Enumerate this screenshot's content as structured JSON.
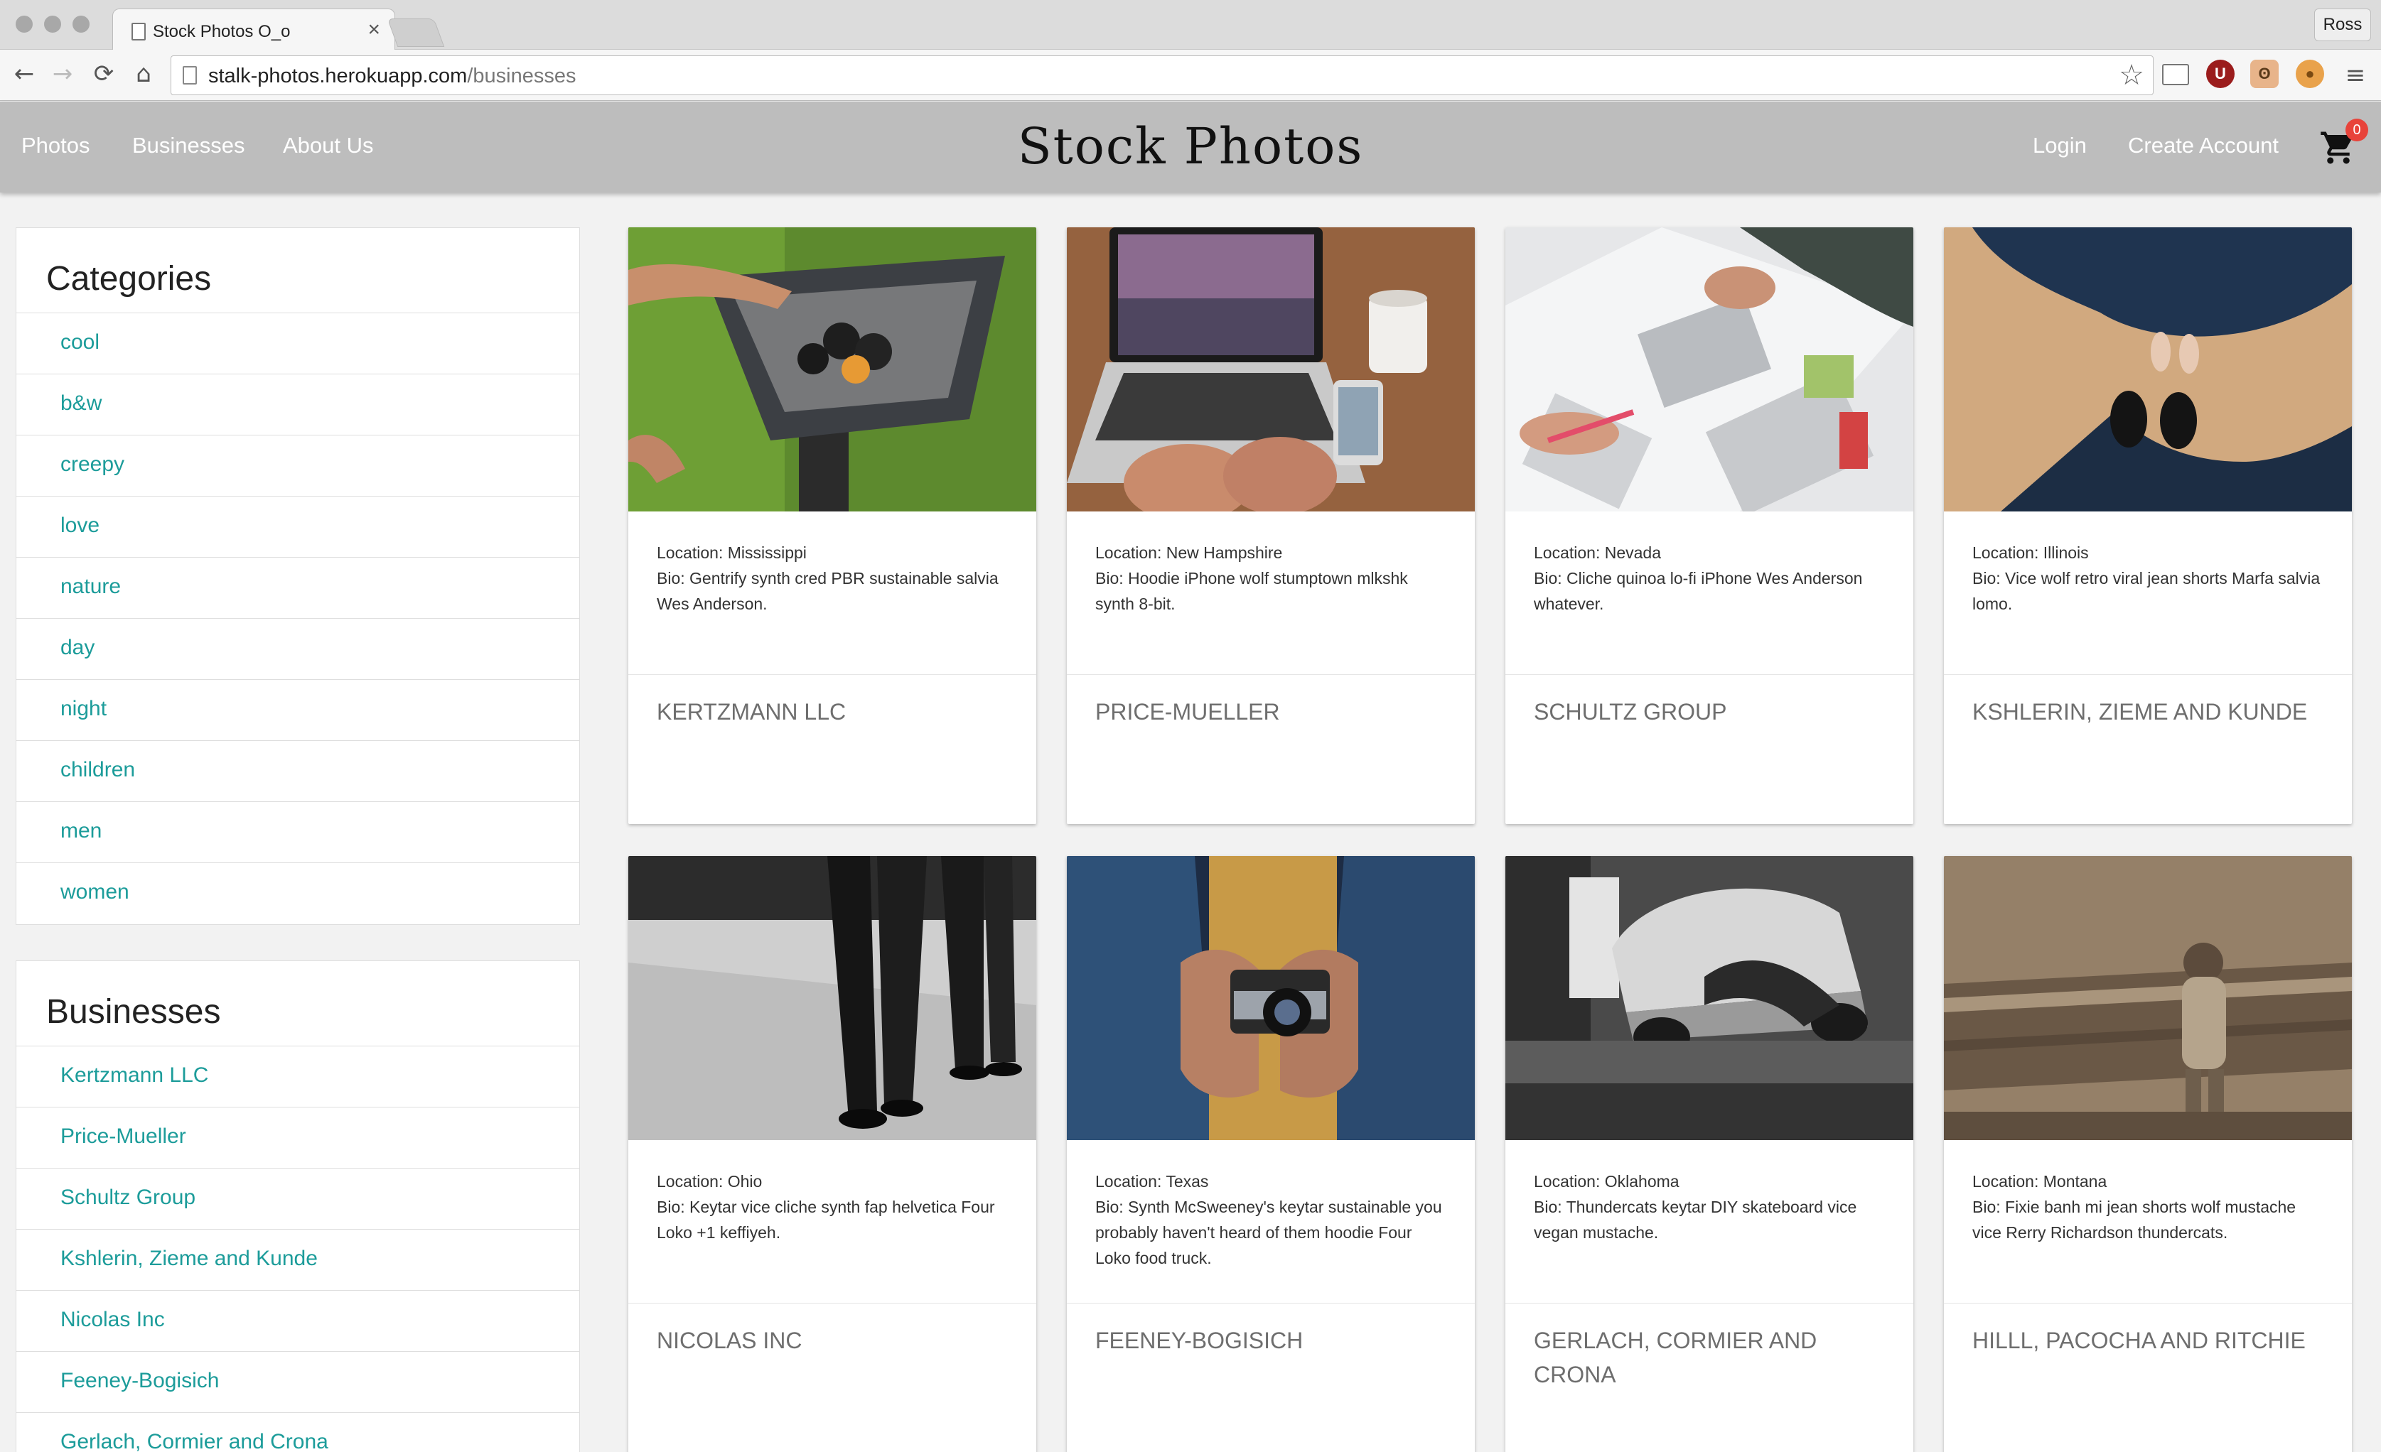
{
  "browser": {
    "tab_title": "Stock Photos O_o",
    "url_host": "stalk-photos.herokuapp.com",
    "url_path": "/businesses",
    "profile_name": "Ross"
  },
  "nav": {
    "left_links": [
      "Photos",
      "Businesses",
      "About Us"
    ],
    "brand": "Stock Photos",
    "login": "Login",
    "create_account": "Create Account",
    "cart_count": "0"
  },
  "categories": {
    "title": "Categories",
    "items": [
      "cool",
      "b&w",
      "creepy",
      "love",
      "nature",
      "day",
      "night",
      "children",
      "men",
      "women"
    ]
  },
  "businesses": {
    "title": "Businesses",
    "items": [
      "Kertzmann LLC",
      "Price-Mueller",
      "Schultz Group",
      "Kshlerin, Zieme and Kunde",
      "Nicolas Inc",
      "Feeney-Bogisich",
      "Gerlach, Cormier and Crona"
    ]
  },
  "cards": [
    {
      "location": "Location: Mississippi",
      "bio": "Bio: Gentrify synth cred PBR sustainable salvia Wes Anderson.",
      "name": "KERTZMANN LLC",
      "image": "grill-photo"
    },
    {
      "location": "Location: New Hampshire",
      "bio": "Bio: Hoodie iPhone wolf stumptown mlkshk synth 8-bit.",
      "name": "PRICE-MUELLER",
      "image": "laptop-desk-photo"
    },
    {
      "location": "Location: Nevada",
      "bio": "Bio: Cliche quinoa lo-fi iPhone Wes Anderson whatever.",
      "name": "SCHULTZ GROUP",
      "image": "magazine-layout-photo"
    },
    {
      "location": "Location: Illinois",
      "bio": "Bio: Vice wolf retro viral jean shorts Marfa salvia lomo.",
      "name": "KSHLERIN, ZIEME AND KUNDE",
      "image": "wedding-shoes-photo"
    },
    {
      "location": "Location: Ohio",
      "bio": "Bio: Keytar vice cliche synth fap helvetica Four Loko +1 keffiyeh.",
      "name": "NICOLAS INC",
      "image": "men-legs-street-photo"
    },
    {
      "location": "Location: Texas",
      "bio": "Bio: Synth McSweeney's keytar sustainable you probably haven't heard of them hoodie Four Loko food truck.",
      "name": "FEENEY-BOGISICH",
      "image": "camera-hands-photo"
    },
    {
      "location": "Location: Oklahoma",
      "bio": "Bio: Thundercats keytar DIY skateboard vice vegan mustache.",
      "name": "GERLACH, CORMIER AND CRONA",
      "image": "car-mechanic-photo"
    },
    {
      "location": "Location: Montana",
      "bio": "Bio: Fixie banh mi jean shorts wolf mustache vice Rerry Richardson thundercats.",
      "name": "HILLL, PACOCHA AND RITCHIE",
      "image": "child-log-photo"
    }
  ],
  "colors": {
    "nav_bg": "#bdbdbd",
    "link_teal": "#1c9c9a",
    "badge_red": "#e8433a"
  }
}
